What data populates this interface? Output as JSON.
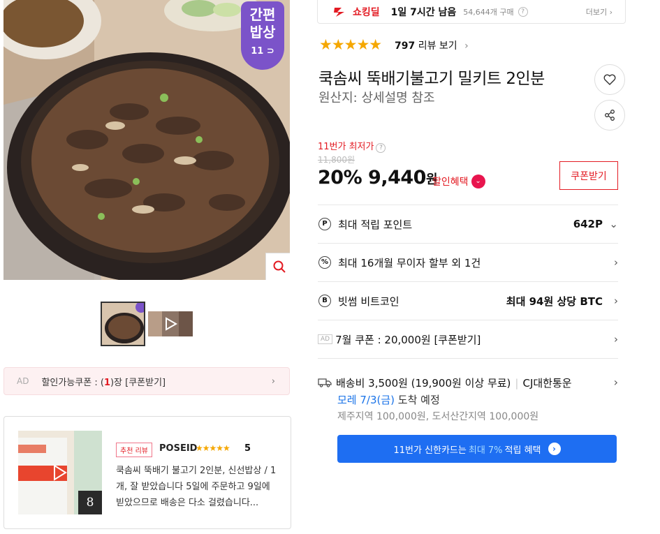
{
  "gallery": {
    "badge_line1": "간편",
    "badge_line2": "밥상",
    "badge_brand": "11",
    "ad_label": "AD",
    "coupon_text_pre": "할인가능쿠폰 : (",
    "coupon_count": "1",
    "coupon_text_post": ")장 [쿠폰받기]"
  },
  "review": {
    "tag": "추천 리뷰",
    "user": "POSEID",
    "stars": "★★★★★",
    "score": "5",
    "text": "쿡솜씨 뚝배기 불고기 2인분, 신선밥상 / 1개, 잘 받았습니다 5일에 주문하고 9일에 빋았으므로 배송은 다소 걸렸습니다...",
    "image_count": "8"
  },
  "shocking": {
    "label": "쇼킹딜",
    "time_left": "1일 7시간 남음",
    "buyers": "54,644개 구매",
    "more": "더보기"
  },
  "rating": {
    "stars": "★★★★★",
    "count": "797",
    "link": "리뷰 보기"
  },
  "product": {
    "title": "쿡솜씨 뚝배기불고기 밀키트 2인분",
    "origin": "원산지:  상세설명 참조"
  },
  "pricing": {
    "lowest_label": "11번가 최저가",
    "original_price": "11,800원",
    "discount": "20%",
    "price": "9,440",
    "unit": "원",
    "discount_link": "할인혜택",
    "coupon_button": "쿠폰받기"
  },
  "benefits": [
    {
      "icon": "P",
      "label": "최대 적립 포인트",
      "value": "642P",
      "chev": "⌄"
    },
    {
      "icon": "%",
      "label": "최대 16개월 무이자 할부 외 1건",
      "value": "",
      "chev": "›"
    },
    {
      "icon": "B",
      "label": "빗썸 비트코인",
      "value": "최대 94원 상당 BTC",
      "chev": "›"
    },
    {
      "icon": "AD",
      "label": "7월 쿠폰 : 20,000원 [쿠폰받기]",
      "value": "",
      "chev": "›"
    }
  ],
  "shipping": {
    "fee": "배송비 3,500원 (19,900원 이상 무료)",
    "carrier": "CJ대한통운",
    "arrival_date": "모레 7/3(금)",
    "arrival_suffix": " 도착 예정",
    "extra": "제주지역 100,000원, 도서산간지역 100,000원"
  },
  "card_banner": {
    "pre": "11번가 신한카드는",
    "highlight": "최대 7%",
    "post": "적립 혜택"
  },
  "colors": {
    "accent_red": "#e31b23",
    "badge_purple": "#7b53c9",
    "banner_blue": "#1e6ef2",
    "star": "#f5a700"
  }
}
